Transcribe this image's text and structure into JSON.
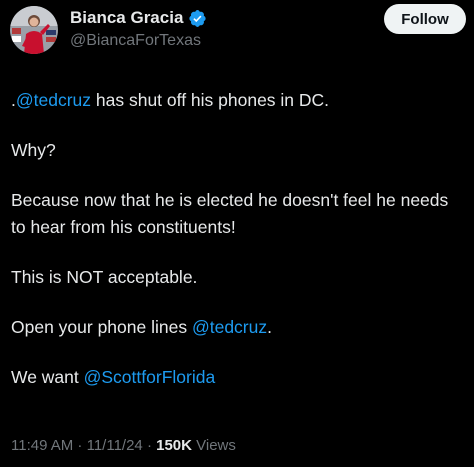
{
  "author": {
    "display_name": "Bianca Gracia",
    "handle": "@BiancaForTexas",
    "verified": true,
    "verified_color": "#1d9bf0"
  },
  "follow_button": {
    "label": "Follow"
  },
  "tweet": {
    "line1": {
      "prefix": ".",
      "mention": "@tedcruz",
      "rest": " has shut off his phones in DC."
    },
    "line2": "Why?",
    "line3": "Because now that he is elected he doesn't feel he needs to hear from his constituents!",
    "line4": "This is NOT acceptable.",
    "line5": {
      "text": "Open your phone lines ",
      "mention": "@tedcruz",
      "suffix": "."
    },
    "line6": {
      "text": "We want ",
      "mention": "@ScottforFlorida"
    }
  },
  "meta": {
    "time": "11:49 AM",
    "sep1": " · ",
    "date": "11/11/24",
    "sep2": " · ",
    "views_count": "150K",
    "views_label": " Views"
  },
  "colors": {
    "background": "#000000",
    "text": "#e7e9ea",
    "secondary": "#71767b",
    "link": "#1d9bf0"
  },
  "icons": {
    "verified": "verified-badge-icon",
    "avatar": "profile-photo"
  }
}
